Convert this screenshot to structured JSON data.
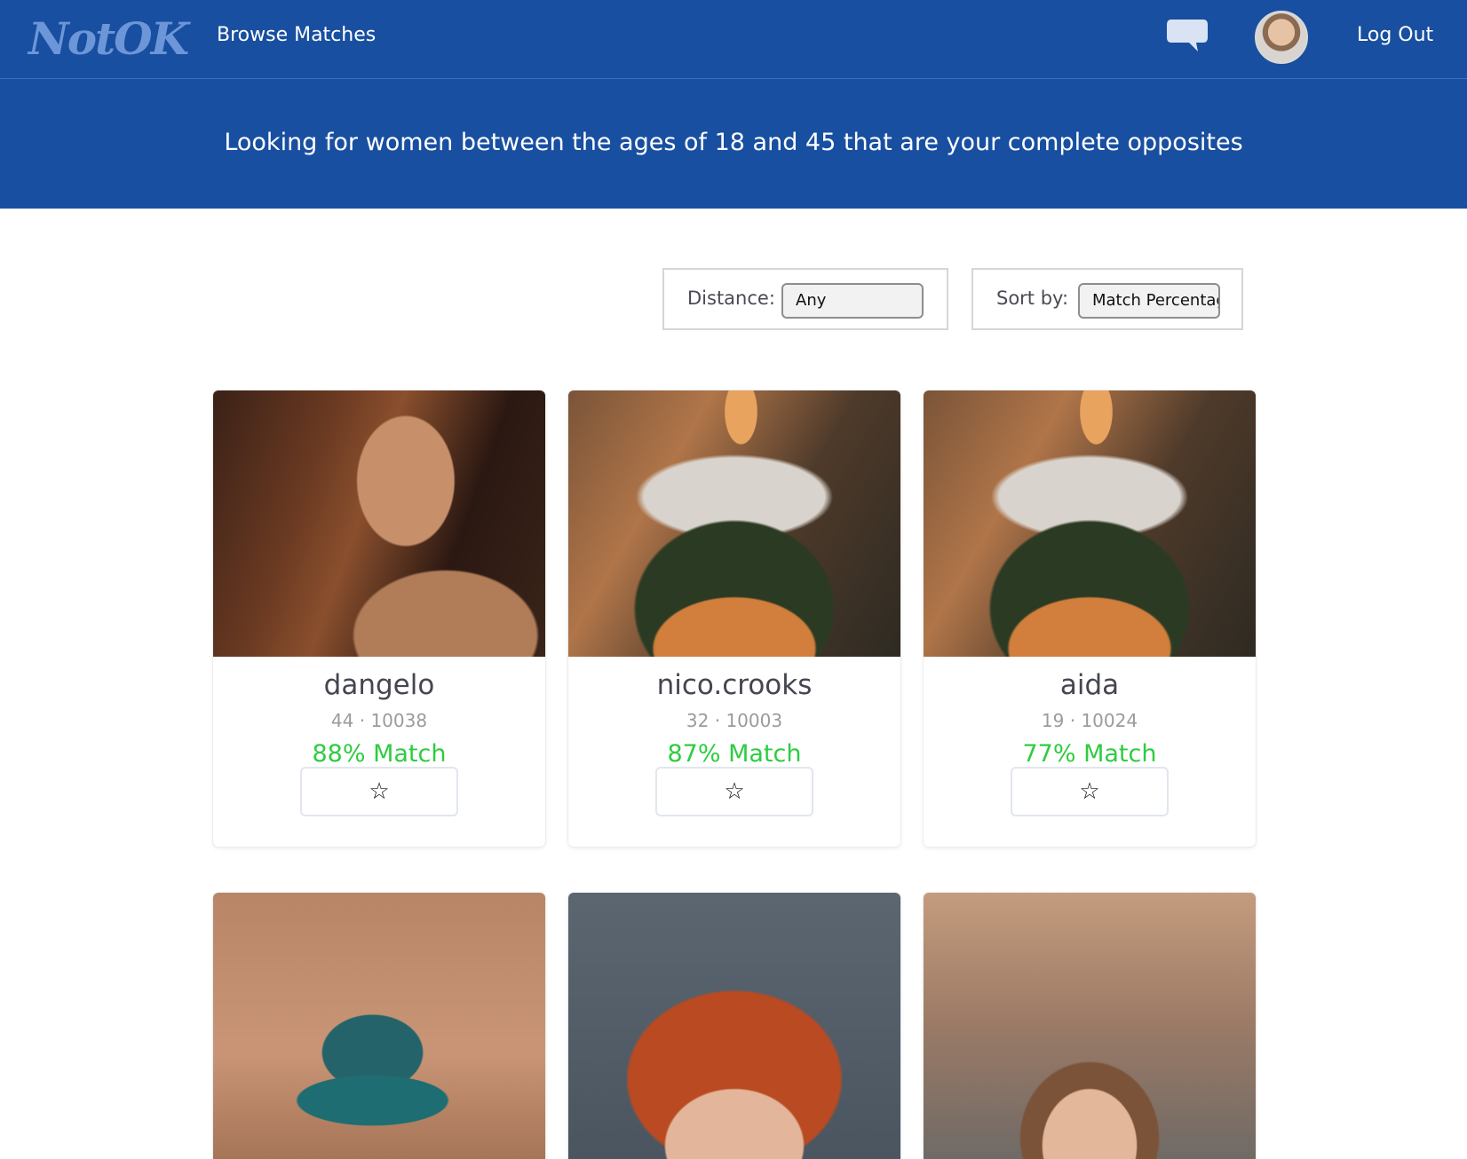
{
  "header": {
    "logo_text": "NotOK",
    "browse_link": "Browse Matches",
    "logout_link": "Log Out",
    "chat_icon": "speech-bubble-icon",
    "brand_color": "#184fa0"
  },
  "banner": {
    "text": "Looking for women between the ages of 18 and 45 that are your complete opposites"
  },
  "filters": {
    "distance_label": "Distance:",
    "distance_value": "Any",
    "sort_label": "Sort by:",
    "sort_value": "Match Percentage"
  },
  "matches": [
    {
      "name": "dangelo",
      "meta": "44 · 10038",
      "match": "88% Match",
      "star": "☆"
    },
    {
      "name": "nico.crooks",
      "meta": "32 · 10003",
      "match": "87% Match",
      "star": "☆"
    },
    {
      "name": "aida",
      "meta": "19 · 10024",
      "match": "77% Match",
      "star": "☆"
    }
  ],
  "colors": {
    "match_green": "#2ecc40"
  }
}
